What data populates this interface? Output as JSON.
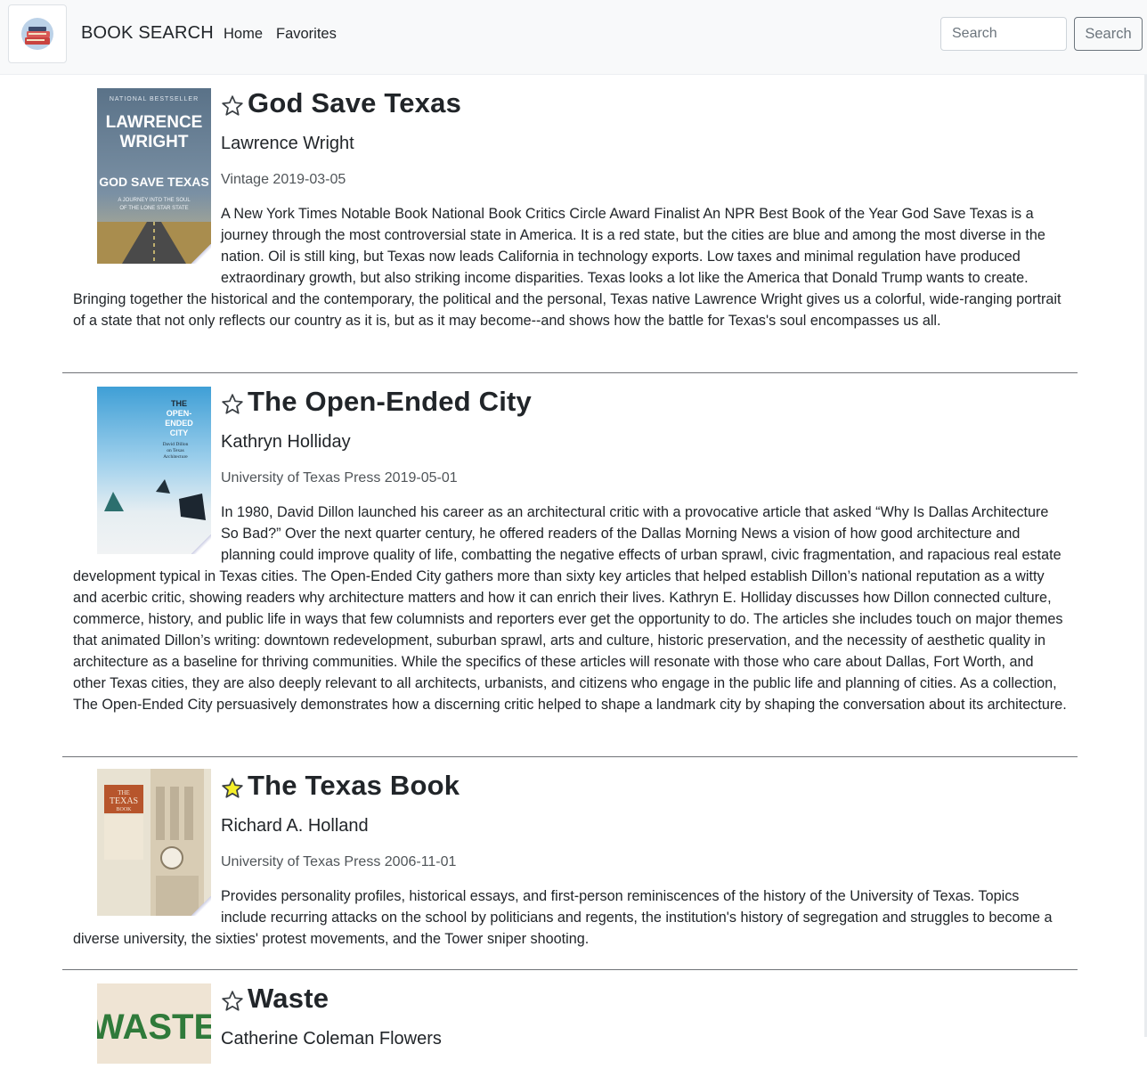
{
  "navbar": {
    "brand": "BOOK SEARCH",
    "links": [
      "Home",
      "Favorites"
    ],
    "search_placeholder": "Search",
    "search_button": "Search"
  },
  "books": [
    {
      "title": "God Save Texas",
      "author": "Lawrence Wright",
      "publisher_date": "Vintage 2019-03-05",
      "favorite": false,
      "cover": {
        "top_text": "NATIONAL BESTSELLER",
        "author": "LAWRENCE WRIGHT",
        "title": "GOD SAVE TEXAS",
        "subtitle": "A JOURNEY INTO THE SOUL OF THE LONE STAR STATE"
      },
      "description": "A New York Times Notable Book National Book Critics Circle Award Finalist An NPR Best Book of the Year God Save Texas is a journey through the most controversial state in America. It is a red state, but the cities are blue and among the most diverse in the nation. Oil is still king, but Texas now leads California in technology exports. Low taxes and minimal regulation have produced extraordinary growth, but also striking income disparities. Texas looks a lot like the America that Donald Trump wants to create. Bringing together the historical and the contemporary, the political and the personal, Texas native Lawrence Wright gives us a colorful, wide-ranging portrait of a state that not only reflects our country as it is, but as it may become--and shows how the battle for Texas's soul encompasses us all."
    },
    {
      "title": "The Open-Ended City",
      "author": "Kathryn Holliday",
      "publisher_date": "University of Texas Press 2019-05-01",
      "favorite": false,
      "cover": {
        "title": "THE OPEN-ENDED CITY",
        "subtitle": "David Dillon on Texas Architecture"
      },
      "description": "In 1980, David Dillon launched his career as an architectural critic with a provocative article that asked “Why Is Dallas Architecture So Bad?” Over the next quarter century, he offered readers of the Dallas Morning News a vision of how good architecture and planning could improve quality of life, combatting the negative effects of urban sprawl, civic fragmentation, and rapacious real estate development typical in Texas cities. The Open-Ended City gathers more than sixty key articles that helped establish Dillon’s national reputation as a witty and acerbic critic, showing readers why architecture matters and how it can enrich their lives. Kathryn E. Holliday discusses how Dillon connected culture, commerce, history, and public life in ways that few columnists and reporters ever get the opportunity to do. The articles she includes touch on major themes that animated Dillon’s writing: downtown redevelopment, suburban sprawl, arts and culture, historic preservation, and the necessity of aesthetic quality in architecture as a baseline for thriving communities. While the specifics of these articles will resonate with those who care about Dallas, Fort Worth, and other Texas cities, they are also deeply relevant to all architects, urbanists, and citizens who engage in the public life and planning of cities. As a collection, The Open-Ended City persuasively demonstrates how a discerning critic helped to shape a landmark city by shaping the conversation about its architecture."
    },
    {
      "title": "The Texas Book",
      "author": "Richard A. Holland",
      "publisher_date": "University of Texas Press 2006-11-01",
      "favorite": true,
      "cover": {
        "title": "THE TEXAS BOOK"
      },
      "description": "Provides personality profiles, historical essays, and first-person reminiscences of the history of the University of Texas. Topics include recurring attacks on the school by politicians and regents, the institution's history of segregation and struggles to become a diverse university, the sixties' protest movements, and the Tower sniper shooting."
    },
    {
      "title": "Waste",
      "author": "Catherine Coleman Flowers",
      "publisher_date": "",
      "favorite": false,
      "cover": {
        "title": "WASTE"
      },
      "description": ""
    }
  ],
  "colors": {
    "navbar_bg": "#f8f9fa",
    "star_favorite": "#f5ef2a",
    "star_default": "#ffffff",
    "divider": "#6f7277"
  }
}
